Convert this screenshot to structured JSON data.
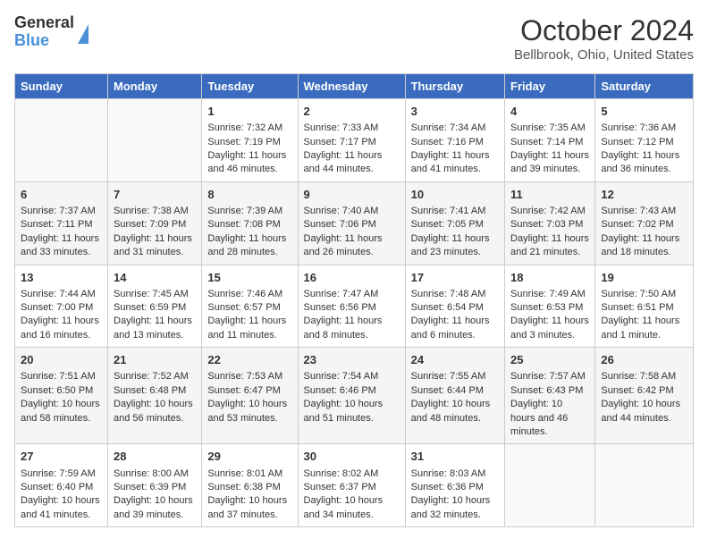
{
  "header": {
    "logo": {
      "line1": "General",
      "line2": "Blue"
    },
    "title": "October 2024",
    "subtitle": "Bellbrook, Ohio, United States"
  },
  "days_of_week": [
    "Sunday",
    "Monday",
    "Tuesday",
    "Wednesday",
    "Thursday",
    "Friday",
    "Saturday"
  ],
  "weeks": [
    [
      {
        "day": "",
        "data": ""
      },
      {
        "day": "",
        "data": ""
      },
      {
        "day": "1",
        "data": "Sunrise: 7:32 AM\nSunset: 7:19 PM\nDaylight: 11 hours and 46 minutes."
      },
      {
        "day": "2",
        "data": "Sunrise: 7:33 AM\nSunset: 7:17 PM\nDaylight: 11 hours and 44 minutes."
      },
      {
        "day": "3",
        "data": "Sunrise: 7:34 AM\nSunset: 7:16 PM\nDaylight: 11 hours and 41 minutes."
      },
      {
        "day": "4",
        "data": "Sunrise: 7:35 AM\nSunset: 7:14 PM\nDaylight: 11 hours and 39 minutes."
      },
      {
        "day": "5",
        "data": "Sunrise: 7:36 AM\nSunset: 7:12 PM\nDaylight: 11 hours and 36 minutes."
      }
    ],
    [
      {
        "day": "6",
        "data": "Sunrise: 7:37 AM\nSunset: 7:11 PM\nDaylight: 11 hours and 33 minutes."
      },
      {
        "day": "7",
        "data": "Sunrise: 7:38 AM\nSunset: 7:09 PM\nDaylight: 11 hours and 31 minutes."
      },
      {
        "day": "8",
        "data": "Sunrise: 7:39 AM\nSunset: 7:08 PM\nDaylight: 11 hours and 28 minutes."
      },
      {
        "day": "9",
        "data": "Sunrise: 7:40 AM\nSunset: 7:06 PM\nDaylight: 11 hours and 26 minutes."
      },
      {
        "day": "10",
        "data": "Sunrise: 7:41 AM\nSunset: 7:05 PM\nDaylight: 11 hours and 23 minutes."
      },
      {
        "day": "11",
        "data": "Sunrise: 7:42 AM\nSunset: 7:03 PM\nDaylight: 11 hours and 21 minutes."
      },
      {
        "day": "12",
        "data": "Sunrise: 7:43 AM\nSunset: 7:02 PM\nDaylight: 11 hours and 18 minutes."
      }
    ],
    [
      {
        "day": "13",
        "data": "Sunrise: 7:44 AM\nSunset: 7:00 PM\nDaylight: 11 hours and 16 minutes."
      },
      {
        "day": "14",
        "data": "Sunrise: 7:45 AM\nSunset: 6:59 PM\nDaylight: 11 hours and 13 minutes."
      },
      {
        "day": "15",
        "data": "Sunrise: 7:46 AM\nSunset: 6:57 PM\nDaylight: 11 hours and 11 minutes."
      },
      {
        "day": "16",
        "data": "Sunrise: 7:47 AM\nSunset: 6:56 PM\nDaylight: 11 hours and 8 minutes."
      },
      {
        "day": "17",
        "data": "Sunrise: 7:48 AM\nSunset: 6:54 PM\nDaylight: 11 hours and 6 minutes."
      },
      {
        "day": "18",
        "data": "Sunrise: 7:49 AM\nSunset: 6:53 PM\nDaylight: 11 hours and 3 minutes."
      },
      {
        "day": "19",
        "data": "Sunrise: 7:50 AM\nSunset: 6:51 PM\nDaylight: 11 hours and 1 minute."
      }
    ],
    [
      {
        "day": "20",
        "data": "Sunrise: 7:51 AM\nSunset: 6:50 PM\nDaylight: 10 hours and 58 minutes."
      },
      {
        "day": "21",
        "data": "Sunrise: 7:52 AM\nSunset: 6:48 PM\nDaylight: 10 hours and 56 minutes."
      },
      {
        "day": "22",
        "data": "Sunrise: 7:53 AM\nSunset: 6:47 PM\nDaylight: 10 hours and 53 minutes."
      },
      {
        "day": "23",
        "data": "Sunrise: 7:54 AM\nSunset: 6:46 PM\nDaylight: 10 hours and 51 minutes."
      },
      {
        "day": "24",
        "data": "Sunrise: 7:55 AM\nSunset: 6:44 PM\nDaylight: 10 hours and 48 minutes."
      },
      {
        "day": "25",
        "data": "Sunrise: 7:57 AM\nSunset: 6:43 PM\nDaylight: 10 hours and 46 minutes."
      },
      {
        "day": "26",
        "data": "Sunrise: 7:58 AM\nSunset: 6:42 PM\nDaylight: 10 hours and 44 minutes."
      }
    ],
    [
      {
        "day": "27",
        "data": "Sunrise: 7:59 AM\nSunset: 6:40 PM\nDaylight: 10 hours and 41 minutes."
      },
      {
        "day": "28",
        "data": "Sunrise: 8:00 AM\nSunset: 6:39 PM\nDaylight: 10 hours and 39 minutes."
      },
      {
        "day": "29",
        "data": "Sunrise: 8:01 AM\nSunset: 6:38 PM\nDaylight: 10 hours and 37 minutes."
      },
      {
        "day": "30",
        "data": "Sunrise: 8:02 AM\nSunset: 6:37 PM\nDaylight: 10 hours and 34 minutes."
      },
      {
        "day": "31",
        "data": "Sunrise: 8:03 AM\nSunset: 6:36 PM\nDaylight: 10 hours and 32 minutes."
      },
      {
        "day": "",
        "data": ""
      },
      {
        "day": "",
        "data": ""
      }
    ]
  ]
}
